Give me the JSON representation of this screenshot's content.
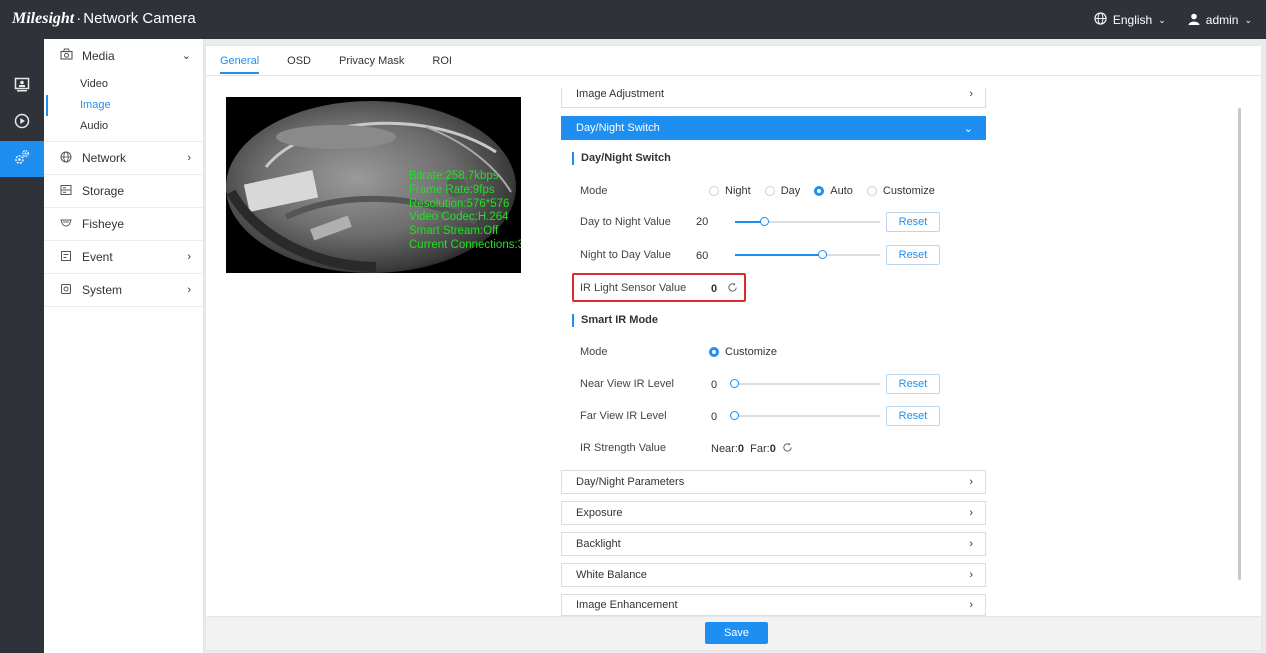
{
  "app": {
    "logo": "Milesight",
    "sep": "·",
    "title": "Network Camera"
  },
  "header": {
    "language": "English",
    "user": "admin"
  },
  "sidebar": {
    "media": {
      "label": "Media",
      "sub": [
        "Video",
        "Image",
        "Audio"
      ]
    },
    "items": [
      "Network",
      "Storage",
      "Fisheye",
      "Event",
      "System"
    ]
  },
  "tabs": [
    "General",
    "OSD",
    "Privacy Mask",
    "ROI"
  ],
  "preview": {
    "osd": [
      "Bitrate:258.7kbps",
      "Frame Rate:9fps",
      "Resolution:576*576",
      "Video Codec:H.264",
      "Smart Stream:Off",
      "Current Connections:3"
    ]
  },
  "panels": {
    "image_adjustment": "Image Adjustment",
    "day_night_switch": "Day/Night Switch",
    "day_night_parameters": "Day/Night Parameters",
    "exposure": "Exposure",
    "backlight": "Backlight",
    "white_balance": "White Balance",
    "image_enhancement": "Image Enhancement"
  },
  "day_night": {
    "section": "Day/Night Switch",
    "mode_label": "Mode",
    "modes": [
      "Night",
      "Day",
      "Auto",
      "Customize"
    ],
    "selected_mode": "Auto",
    "d2n_label": "Day to Night Value",
    "d2n_value": "20",
    "d2n_fraction": 0.2,
    "n2d_label": "Night to Day Value",
    "n2d_value": "60",
    "n2d_fraction": 0.6,
    "ir_label": "IR Light Sensor Value",
    "ir_value": "0",
    "reset": "Reset"
  },
  "smart_ir": {
    "section": "Smart IR Mode",
    "mode_label": "Mode",
    "mode_value": "Customize",
    "near_label": "Near View IR Level",
    "near_value": "0",
    "far_label": "Far View IR Level",
    "far_value": "0",
    "strength_label": "IR Strength Value",
    "near_prefix": "Near:",
    "near_strength": "0",
    "far_prefix": "Far:",
    "far_strength": "0",
    "reset": "Reset"
  },
  "save": "Save",
  "colors": {
    "accent": "#1f8ef1",
    "topbar": "#2f3339",
    "highlight": "#e02a2a",
    "osd_text": "#22e022"
  },
  "icons": {
    "rail": [
      "monitor-icon",
      "playback-icon",
      "settings-icon"
    ]
  }
}
